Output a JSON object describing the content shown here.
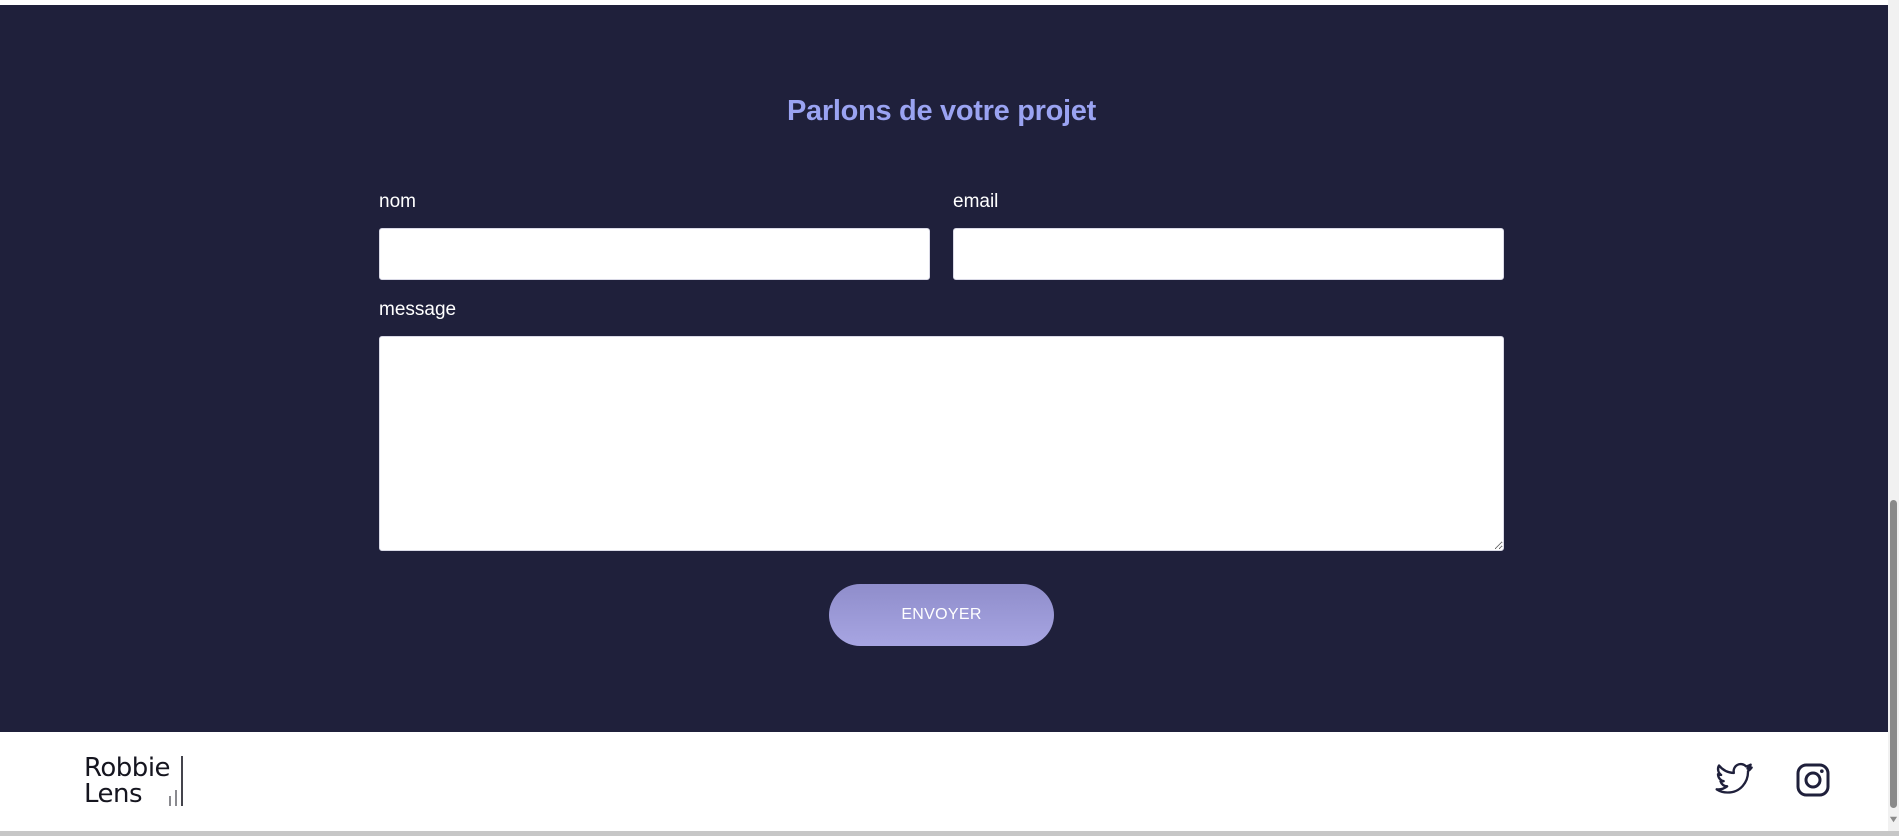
{
  "contact": {
    "title": "Parlons de votre projet",
    "fields": {
      "name_label": "nom",
      "email_label": "email",
      "message_label": "message",
      "name_value": "",
      "email_value": "",
      "message_value": ""
    },
    "submit_label": "ENVOYER"
  },
  "footer": {
    "logo_line_1": "Robbie",
    "logo_line_2": "Lens",
    "social": [
      "twitter-icon",
      "instagram-icon"
    ]
  },
  "colors": {
    "section_bg": "#1f203b",
    "title": "#9aa3f2",
    "button_gradient_start": "#8f8dcb",
    "button_gradient_end": "#a7a5e2",
    "footer_bg": "#ffffff",
    "icon": "#1f203b"
  }
}
